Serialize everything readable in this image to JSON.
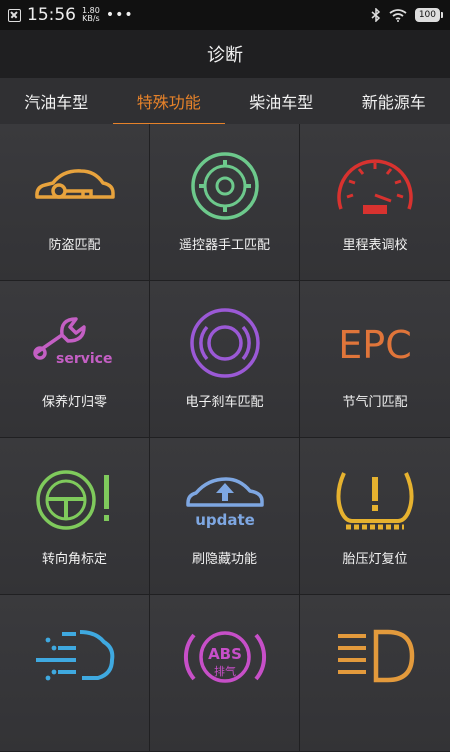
{
  "status": {
    "time": "15:56",
    "net_speed": "1.80",
    "net_unit": "KB/s",
    "dots": "•••",
    "battery": "100"
  },
  "header": {
    "title": "诊断"
  },
  "tabs": [
    {
      "label": "汽油车型"
    },
    {
      "label": "特殊功能"
    },
    {
      "label": "柴油车型"
    },
    {
      "label": "新能源车"
    }
  ],
  "grid": {
    "items": [
      {
        "label": "防盗匹配",
        "icon": "car-key-icon",
        "color": "#e8a33d"
      },
      {
        "label": "遥控器手工匹配",
        "icon": "remote-wheel-icon",
        "color": "#6dc98c"
      },
      {
        "label": "里程表调校",
        "icon": "speedometer-icon",
        "color": "#d8322f"
      },
      {
        "label": "保养灯归零",
        "icon": "service-wrench-icon",
        "color": "#c45fc4",
        "icon_text": "service"
      },
      {
        "label": "电子刹车匹配",
        "icon": "parking-brake-icon",
        "color": "#9b59d6"
      },
      {
        "label": "节气门匹配",
        "icon": "epc-icon",
        "color": "#e0753a",
        "icon_text": "EPC"
      },
      {
        "label": "转向角标定",
        "icon": "steering-warning-icon",
        "color": "#7fca5c"
      },
      {
        "label": "刷隐藏功能",
        "icon": "car-update-icon",
        "color": "#7ea7e2",
        "icon_text": "update"
      },
      {
        "label": "胎压灯复位",
        "icon": "tire-pressure-icon",
        "color": "#e6b22f"
      },
      {
        "label": "",
        "icon": "injector-icon",
        "color": "#3fa9e0"
      },
      {
        "label": "",
        "icon": "abs-icon",
        "color": "#c74fc8",
        "icon_text": "ABS",
        "icon_text2": "排气"
      },
      {
        "label": "",
        "icon": "headlight-icon",
        "color": "#e39a3c"
      }
    ]
  }
}
